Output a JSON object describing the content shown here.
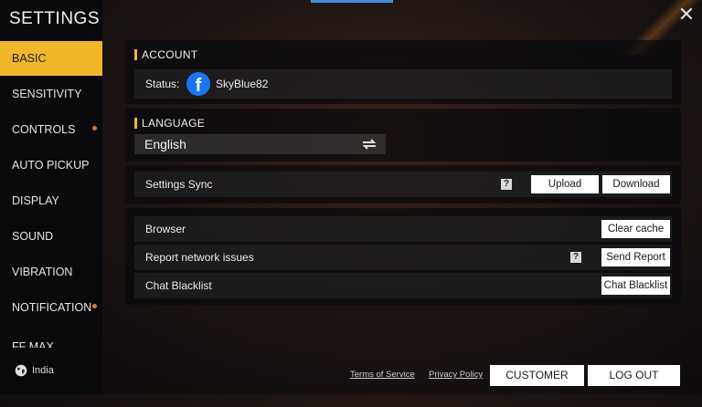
{
  "sidebar": {
    "title": "SETTINGS",
    "items": [
      {
        "label": "BASIC",
        "active": true,
        "dot": false
      },
      {
        "label": "SENSITIVITY",
        "active": false,
        "dot": false
      },
      {
        "label": "CONTROLS",
        "active": false,
        "dot": true
      },
      {
        "label": "AUTO PICKUP",
        "active": false,
        "dot": false
      },
      {
        "label": "DISPLAY",
        "active": false,
        "dot": false
      },
      {
        "label": "SOUND",
        "active": false,
        "dot": false
      },
      {
        "label": "VIBRATION",
        "active": false,
        "dot": false
      },
      {
        "label": "NOTIFICATION",
        "active": false,
        "dot": true
      },
      {
        "label": "FF MAX",
        "active": false,
        "dot": false
      }
    ],
    "region": "India"
  },
  "account": {
    "heading": "ACCOUNT",
    "status_label": "Status:",
    "username": "SkyBlue82",
    "provider_icon": "facebook-icon"
  },
  "language": {
    "heading": "LANGUAGE",
    "selected": "English"
  },
  "sync": {
    "label": "Settings Sync",
    "help": "?",
    "upload_label": "Upload",
    "download_label": "Download"
  },
  "misc": {
    "browser_label": "Browser",
    "clear_cache_label": "Clear cache",
    "report_label": "Report network issues",
    "report_help": "?",
    "send_report_label": "Send Report",
    "blacklist_label": "Chat Blacklist",
    "blacklist_button_label": "Chat Blacklist"
  },
  "footer": {
    "terms_label": "Terms of Service",
    "privacy_label": "Privacy Policy",
    "customer_service_label": "CUSTOMER SERVICE",
    "logout_label": "LOG OUT"
  },
  "colors": {
    "accent": "#f0b72b",
    "notification_dot": "#e8742a",
    "facebook_blue": "#1877f2"
  }
}
